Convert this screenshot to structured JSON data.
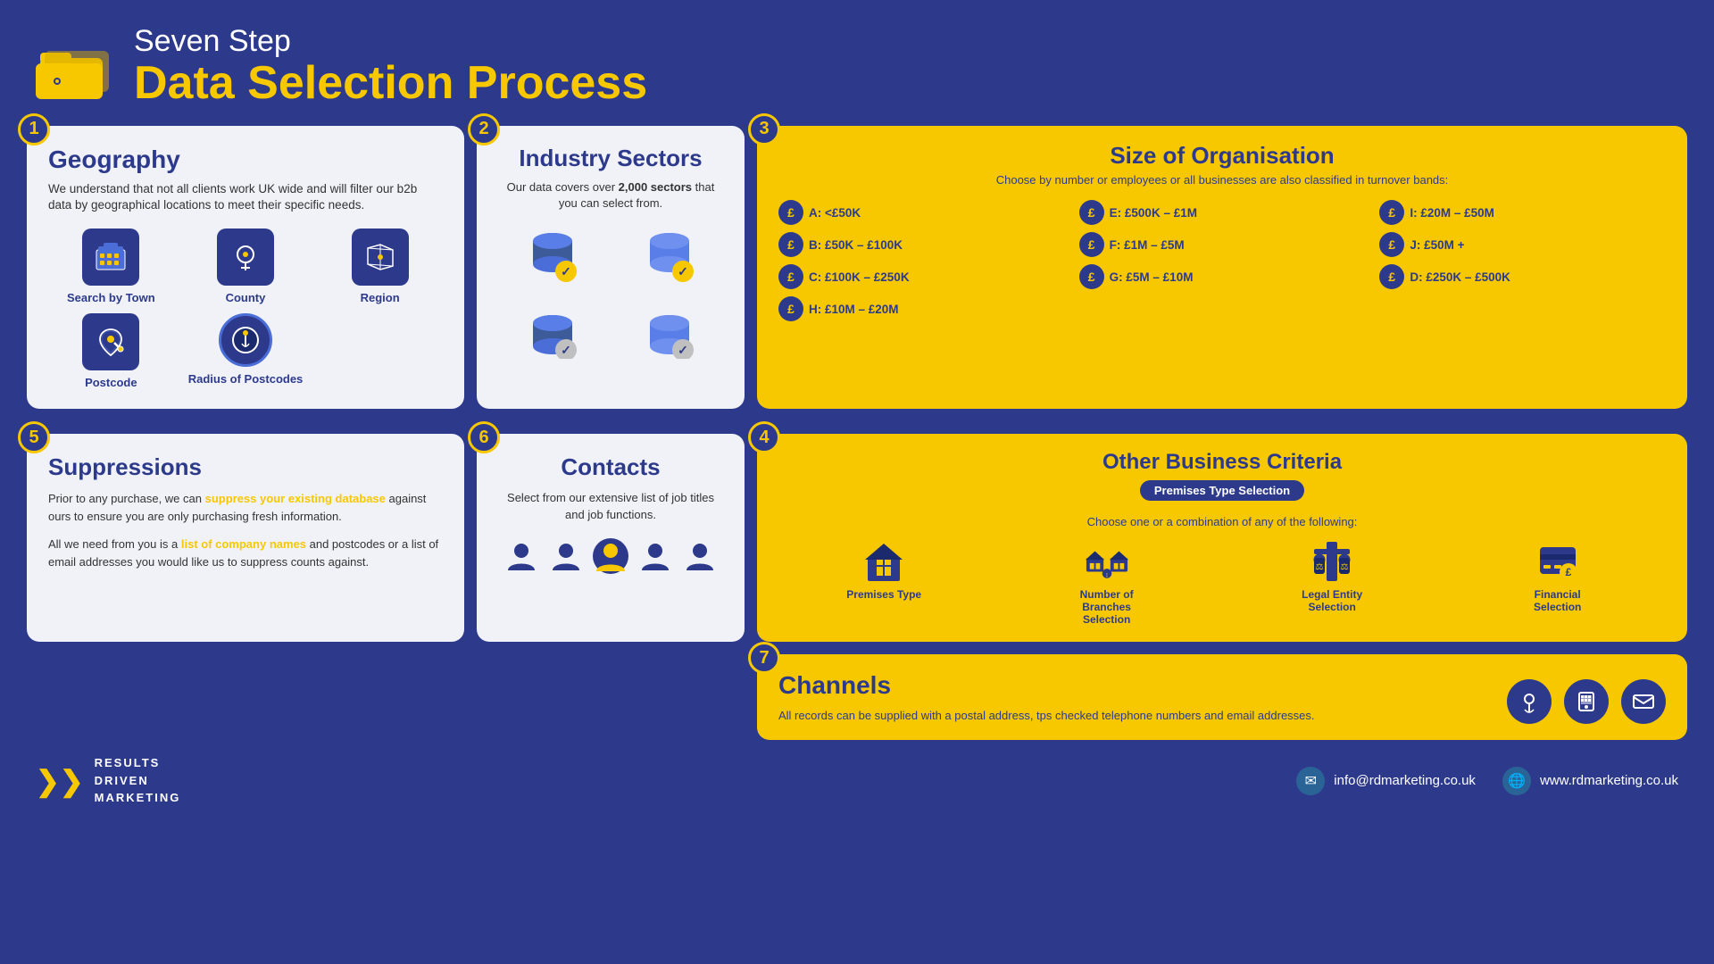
{
  "header": {
    "subtitle": "Seven Step",
    "title": "Data Selection Process"
  },
  "steps": {
    "step1": {
      "number": "1",
      "title": "Geography",
      "description": "We understand that not all clients work UK wide and will filter our b2b data by geographical locations to meet their specific needs.",
      "items": [
        {
          "label": "Search by Town",
          "icon": "🏙"
        },
        {
          "label": "County",
          "icon": "📍"
        },
        {
          "label": "Region",
          "icon": "🗺"
        },
        {
          "label": "Postcode",
          "icon": "📮"
        },
        {
          "label": "Radius of Postcodes",
          "icon": "🎯"
        }
      ]
    },
    "step2": {
      "number": "2",
      "title": "Industry Sectors",
      "description": "Our data covers over 2,000 sectors that you can select from."
    },
    "step3": {
      "number": "3",
      "title": "Size of Organisation",
      "description": "Choose by number or employees or all businesses are also classified in turnover bands:",
      "bands": [
        {
          "label": "A: <£50K"
        },
        {
          "label": "B: £50K – £100K"
        },
        {
          "label": "C: £100K – £250K"
        },
        {
          "label": "D: £250K – £500K"
        },
        {
          "label": "E: £500K – £1M"
        },
        {
          "label": "F: £1M – £5M"
        },
        {
          "label": "G: £5M – £10M"
        },
        {
          "label": "H: £10M – £20M"
        },
        {
          "label": "I: £20M – £50M"
        },
        {
          "label": "J: £50M +"
        }
      ]
    },
    "step4": {
      "number": "4",
      "title": "Other Business Criteria",
      "badge": "Premises Type Selection",
      "description": "Choose one or a combination of any of the following:",
      "items": [
        {
          "label": "Premises Type",
          "icon": "🏢"
        },
        {
          "label": "Number of Branches Selection",
          "icon": "📍"
        },
        {
          "label": "Legal Entity Selection",
          "icon": "⚖"
        },
        {
          "label": "Financial Selection",
          "icon": "💰"
        }
      ]
    },
    "step5": {
      "number": "5",
      "title": "Suppressions",
      "text1": "Prior to any purchase, we can ",
      "highlight1": "suppress your existing database",
      "text2": " against ours to ensure you are only purchasing fresh information.",
      "text3": "All we need from you is a ",
      "highlight2": "list of company names",
      "text4": " and postcodes or a list of email addresses you would like us to suppress counts against."
    },
    "step6": {
      "number": "6",
      "title": "Contacts",
      "description": "Select from our extensive list of job titles and job functions."
    },
    "step7": {
      "number": "7",
      "title": "Channels",
      "description": "All records can be supplied with a postal address, tps checked telephone numbers and email addresses."
    }
  },
  "footer": {
    "logo_lines": [
      "RESULTS",
      "DRIVEN",
      "MARKETING"
    ],
    "email": "info@rdmarketing.co.uk",
    "website": "www.rdmarketing.co.uk"
  }
}
